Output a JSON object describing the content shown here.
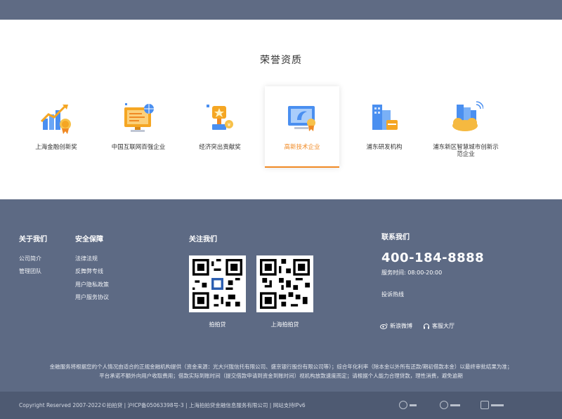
{
  "honors": {
    "title": "荣誉资质",
    "awards": [
      {
        "label": "上海金融创新奖",
        "icon": "bar-chart-award-icon"
      },
      {
        "label": "中国互联网百强企业",
        "icon": "monitor-award-icon"
      },
      {
        "label": "经济突出贡献奖",
        "icon": "trophy-icon"
      },
      {
        "label": "高新技术企业",
        "icon": "certificate-icon",
        "active": true
      },
      {
        "label": "浦东研发机构",
        "icon": "building-icon"
      },
      {
        "label": "浦东新区智慧城市创新示范企业",
        "icon": "smart-city-icon"
      }
    ]
  },
  "footer": {
    "about": {
      "title": "关于我们",
      "links": [
        "公司简介",
        "管理团队"
      ]
    },
    "security": {
      "title": "安全保障",
      "links": [
        "法律法规",
        "反舞弊专线",
        "用户隐私政策",
        "用户服务协议"
      ]
    },
    "follow": {
      "title": "关注我们",
      "qrcodes": [
        "拍拍贷",
        "上海拍拍贷"
      ]
    },
    "contact": {
      "title": "联系我们",
      "phone": "400-184-8888",
      "hours": "服务时间: 08:00-20:00",
      "hotline": "投诉热线",
      "weibo": "新浪微博",
      "service": "客服大厅"
    },
    "disclaimer": [
      "金融服务将根据您的个人情况由适合的正规金融机构提供（资金来源：光大兴陇信托有限公司、盛京银行股份有限公司等）；综合年化利率（除本金以外所有还款/期初借款本金）以最终审批结果为准；",
      "平台承诺不额外向用户收取费用；借款实际到账时间（提交借款申请到资金到账时间）视机构放款速度而定；请根据个人能力合理贷款，理性消费，避免逾期"
    ],
    "copyright": "Copyright Reserved 2007-2022©拍拍贷 | 沪ICP备05063398号-3 | 上海拍拍贷金融信息服务有限公司 | 网站支持IPv6"
  },
  "colors": {
    "accent": "#f08a24",
    "footer_bg": "#5d6a84",
    "bottom_bg": "#4e5a72"
  }
}
